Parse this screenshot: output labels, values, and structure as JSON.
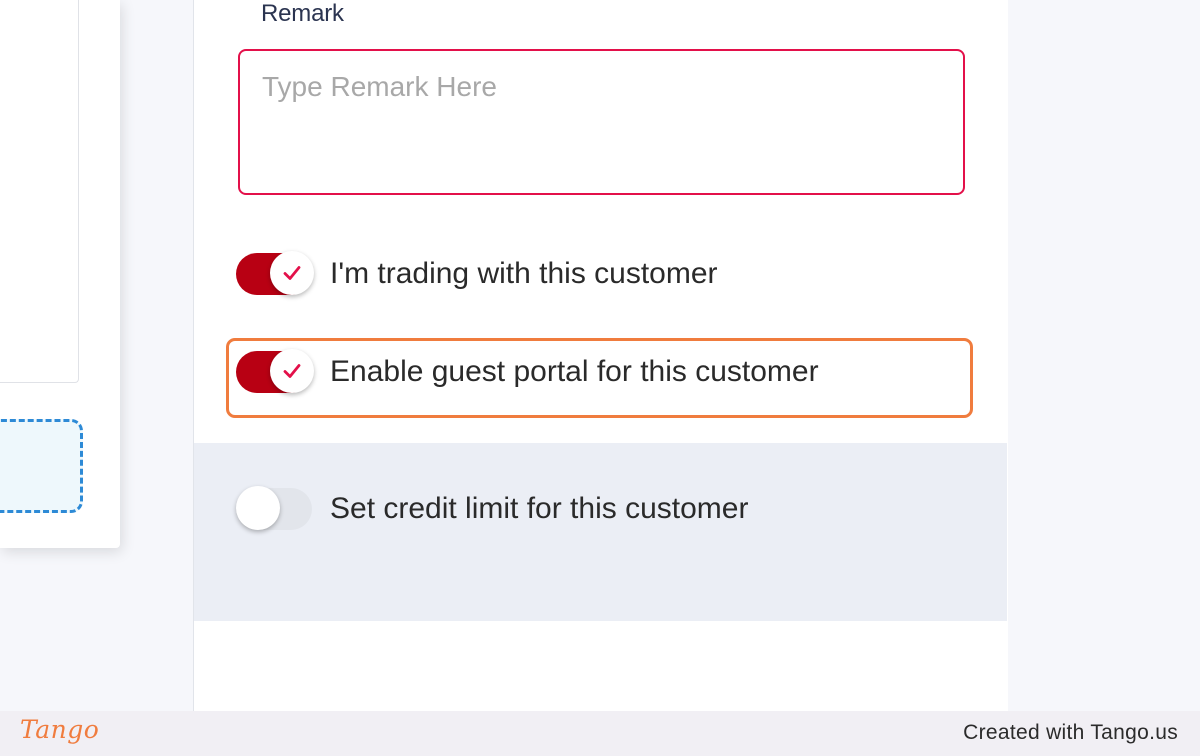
{
  "remark": {
    "label": "Remark",
    "placeholder": "Type Remark Here",
    "value": ""
  },
  "toggles": [
    {
      "label": "I'm trading with this customer",
      "checked": true
    },
    {
      "label": "Enable guest portal for this customer",
      "checked": true
    },
    {
      "label": "Set credit limit for this customer",
      "checked": false
    }
  ],
  "colors": {
    "toggle_on": "#b80013",
    "remark_border": "#e3104a",
    "highlight": "#f07c3e",
    "check_mark": "#e3104a"
  },
  "icons": {
    "toggle_check": "check-icon"
  },
  "footer": {
    "logo": "Tango",
    "credit": "Created with Tango.us"
  }
}
